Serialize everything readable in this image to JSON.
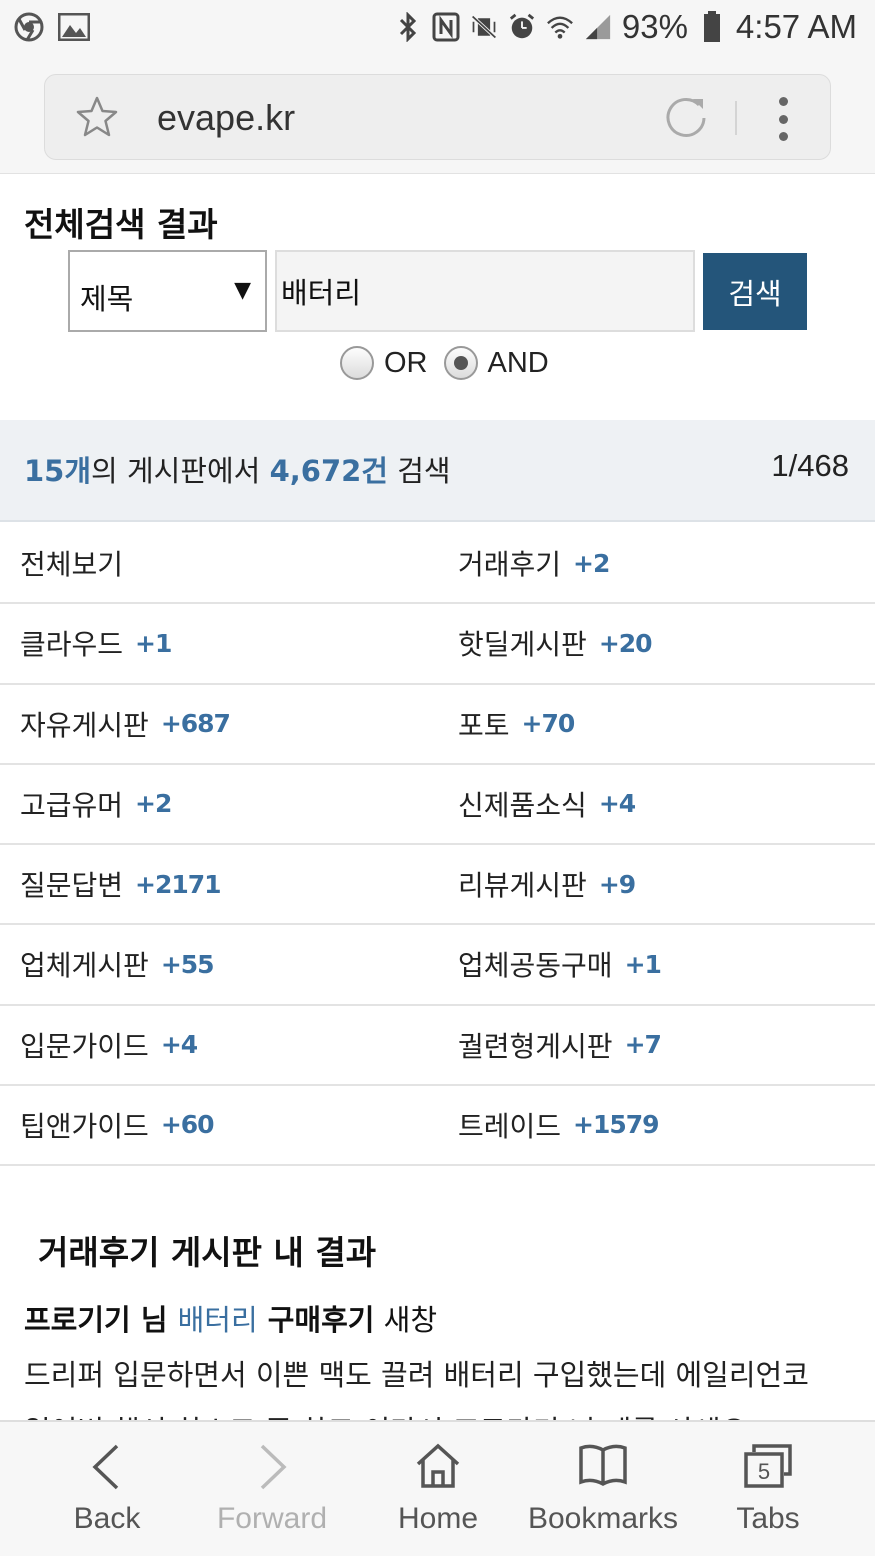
{
  "status_bar": {
    "battery_percent": "93%",
    "time": "4:57 AM"
  },
  "browser": {
    "url": "evape.kr"
  },
  "search": {
    "title": "전체검색 결과",
    "field_select": "제목",
    "query": "배터리",
    "button_label": "검색",
    "mode_options": [
      {
        "label": "OR",
        "selected": false
      },
      {
        "label": "AND",
        "selected": true
      }
    ]
  },
  "summary": {
    "board_count": "15개",
    "board_suffix": "의 게시판에서 ",
    "result_count": "4,672건",
    "result_suffix": " 검색",
    "page": "1/468"
  },
  "boards": [
    {
      "left": {
        "name": "전체보기",
        "count": ""
      },
      "right": {
        "name": "거래후기",
        "count": "+2"
      }
    },
    {
      "left": {
        "name": "클라우드",
        "count": "+1"
      },
      "right": {
        "name": "핫딜게시판",
        "count": "+20"
      }
    },
    {
      "left": {
        "name": "자유게시판",
        "count": "+687"
      },
      "right": {
        "name": "포토",
        "count": "+70"
      }
    },
    {
      "left": {
        "name": "고급유머",
        "count": "+2"
      },
      "right": {
        "name": "신제품소식",
        "count": "+4"
      }
    },
    {
      "left": {
        "name": "질문답변",
        "count": "+2171"
      },
      "right": {
        "name": "리뷰게시판",
        "count": "+9"
      }
    },
    {
      "left": {
        "name": "업체게시판",
        "count": "+55"
      },
      "right": {
        "name": "업체공동구매",
        "count": "+1"
      }
    },
    {
      "left": {
        "name": "입문가이드",
        "count": "+4"
      },
      "right": {
        "name": "궐련형게시판",
        "count": "+7"
      }
    },
    {
      "left": {
        "name": "팁앤가이드",
        "count": "+60"
      },
      "right": {
        "name": "트레이드",
        "count": "+1579"
      }
    }
  ],
  "results_section": {
    "title": "거래후기 게시판 내 결과",
    "post": {
      "title_prefix": "프로기기 님 ",
      "title_keyword": "배터리",
      "title_bold_rest": " 구매후기",
      "title_rest": " 새창",
      "body_line1": "드리퍼 입문하면서 이쁜 맥도 끌려 배터리 구입했는데 에일리언코",
      "body_line2_partial": "일어버 했서 하스고 중 하고 이라시 프로가기 니 계를 사세요"
    }
  },
  "bottom_nav": {
    "back": "Back",
    "forward": "Forward",
    "home": "Home",
    "bookmarks": "Bookmarks",
    "tabs": "Tabs",
    "tab_count": "5"
  }
}
